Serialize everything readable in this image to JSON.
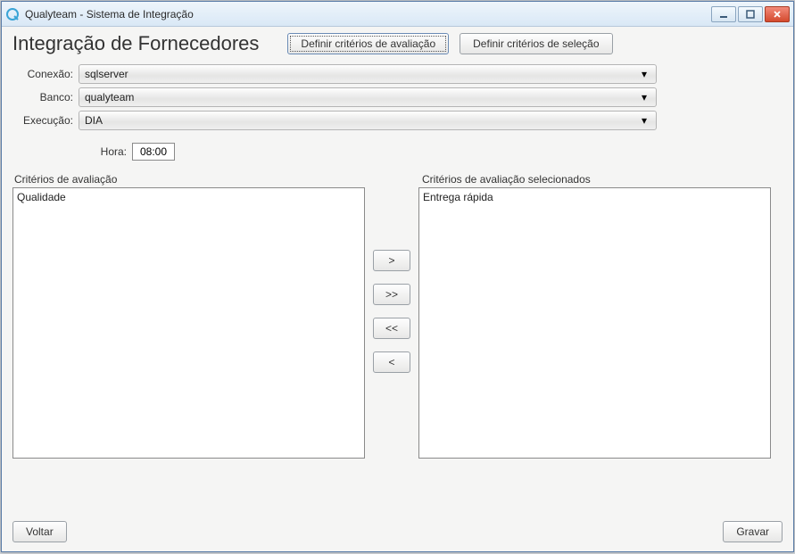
{
  "window": {
    "title": "Qualyteam - Sistema de Integração"
  },
  "page": {
    "title": "Integração de Fornecedores"
  },
  "buttons": {
    "definir_avaliacao": "Definir critérios de avaliação",
    "definir_selecao": "Definir critérios de seleção",
    "voltar": "Voltar",
    "gravar": "Gravar",
    "move_right": ">",
    "move_all_right": ">>",
    "move_all_left": "<<",
    "move_left": "<"
  },
  "form": {
    "conexao_label": "Conexão:",
    "conexao_value": "sqlserver",
    "banco_label": "Banco:",
    "banco_value": "qualyteam",
    "execucao_label": "Execução:",
    "execucao_value": "DIA",
    "hora_label": "Hora:",
    "hora_value": "08:00"
  },
  "criteria": {
    "available_label": "Critérios de avaliação",
    "selected_label": "Critérios de avaliação selecionados",
    "available": [
      "Qualidade"
    ],
    "selected": [
      "Entrega rápida"
    ]
  }
}
